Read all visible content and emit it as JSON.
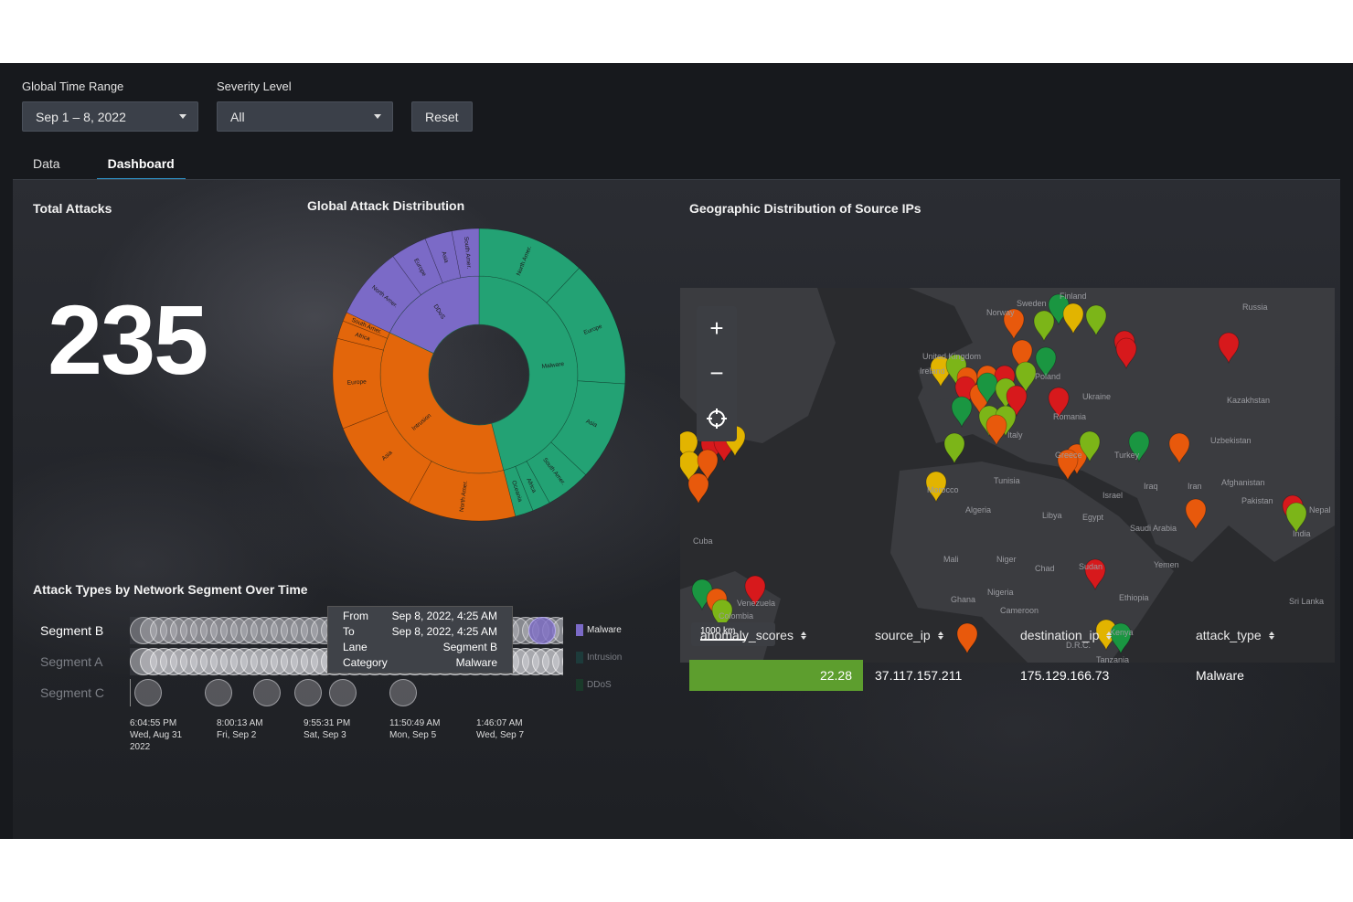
{
  "filters": {
    "time_range": {
      "label": "Global Time Range",
      "value": "Sep 1 – 8, 2022"
    },
    "severity": {
      "label": "Severity Level",
      "value": "All"
    },
    "reset_label": "Reset"
  },
  "tabs": [
    {
      "label": "Data",
      "active": false
    },
    {
      "label": "Dashboard",
      "active": true
    }
  ],
  "total_attacks": {
    "title": "Total Attacks",
    "value": "235"
  },
  "sunburst": {
    "title": "Global Attack Distribution",
    "colors": {
      "Malware": "#23a274",
      "Intrusion": "#e3660b",
      "DDoS": "#7b6ac7"
    }
  },
  "chart_data": {
    "type": "sunburst",
    "title": "Global Attack Distribution",
    "inner": [
      {
        "name": "Malware",
        "value": 46
      },
      {
        "name": "Intrusion",
        "value": 36
      },
      {
        "name": "DDoS",
        "value": 18
      }
    ],
    "outer": [
      {
        "parent": "Malware",
        "name": "North Amer.",
        "value": 12
      },
      {
        "parent": "Malware",
        "name": "Europe",
        "value": 14
      },
      {
        "parent": "Malware",
        "name": "Asia",
        "value": 11
      },
      {
        "parent": "Malware",
        "name": "South Amer.",
        "value": 5
      },
      {
        "parent": "Malware",
        "name": "Africa",
        "value": 2
      },
      {
        "parent": "Malware",
        "name": "Oceania",
        "value": 2
      },
      {
        "parent": "Intrusion",
        "name": "North Amer.",
        "value": 12
      },
      {
        "parent": "Intrusion",
        "name": "Asia",
        "value": 11
      },
      {
        "parent": "Intrusion",
        "name": "Europe",
        "value": 10
      },
      {
        "parent": "Intrusion",
        "name": "Africa",
        "value": 2
      },
      {
        "parent": "Intrusion",
        "name": "South Amer.",
        "value": 1
      },
      {
        "parent": "DDoS",
        "name": "North Amer.",
        "value": 8
      },
      {
        "parent": "DDoS",
        "name": "Europe",
        "value": 4
      },
      {
        "parent": "DDoS",
        "name": "Asia",
        "value": 3
      },
      {
        "parent": "DDoS",
        "name": "South Amer.",
        "value": 3
      }
    ]
  },
  "geo": {
    "title": "Geographic Distribution of Source IPs",
    "scale_label": "1000 km",
    "zoom_in": "+",
    "zoom_out": "−",
    "places": [
      "Sweden",
      "Finland",
      "Russia",
      "Norway",
      "United Kingdom",
      "Ireland",
      "Poland",
      "Ukraine",
      "Kazakhstan",
      "Romania",
      "Uzbekistan",
      "Italy",
      "Turkey",
      "Afghanistan",
      "Pakistan",
      "Nepal",
      "India",
      "Iran",
      "Iraq",
      "Israel",
      "Tunisia",
      "Morocco",
      "Algeria",
      "Libya",
      "Egypt",
      "Saudi Arabia",
      "Cuba",
      "Mali",
      "Niger",
      "Chad",
      "Sudan",
      "Yemen",
      "Venezuela",
      "Colombia",
      "Nigeria",
      "Ghana",
      "Cameroon",
      "Ethiopia",
      "Sri Lanka",
      "D.R.C.",
      "Tanzania",
      "Kenya",
      "Greece"
    ],
    "marker_colors": {
      "red": "#d7191c",
      "orange": "#e8590c",
      "yellow": "#e2b400",
      "lime": "#7cb518",
      "green": "#1a9641"
    }
  },
  "swimlane": {
    "title": "Attack Types by Network Segment Over Time",
    "lanes": [
      "Segment B",
      "Segment A",
      "Segment C"
    ],
    "legend": [
      {
        "name": "Malware",
        "color": "#7b6ac7"
      },
      {
        "name": "Intrusion",
        "color": "#1d6b6b"
      },
      {
        "name": "DDoS",
        "color": "#1a5a3a"
      }
    ],
    "ticks": [
      {
        "time": "6:04:55 PM",
        "date": "Wed, Aug 31",
        "year": "2022"
      },
      {
        "time": "8:00:13 AM",
        "date": "Fri, Sep 2",
        "year": ""
      },
      {
        "time": "9:55:31 PM",
        "date": "Sat, Sep 3",
        "year": ""
      },
      {
        "time": "11:50:49 AM",
        "date": "Mon, Sep 5",
        "year": ""
      },
      {
        "time": "1:46:07 AM",
        "date": "Wed, Sep 7",
        "year": ""
      }
    ],
    "tooltip": {
      "from_label": "From",
      "from_value": "Sep 8, 2022, 4:25 AM",
      "to_label": "To",
      "to_value": "Sep 8, 2022, 4:25 AM",
      "lane_label": "Lane",
      "lane_value": "Segment B",
      "category_label": "Category",
      "category_value": "Malware"
    }
  },
  "table": {
    "columns": [
      "anomaly_scores",
      "source_ip",
      "destination_ip",
      "attack_type"
    ],
    "row": {
      "anomaly_scores": "22.28",
      "source_ip": "37.117.157.211",
      "destination_ip": "175.129.166.73",
      "attack_type": "Malware"
    }
  }
}
